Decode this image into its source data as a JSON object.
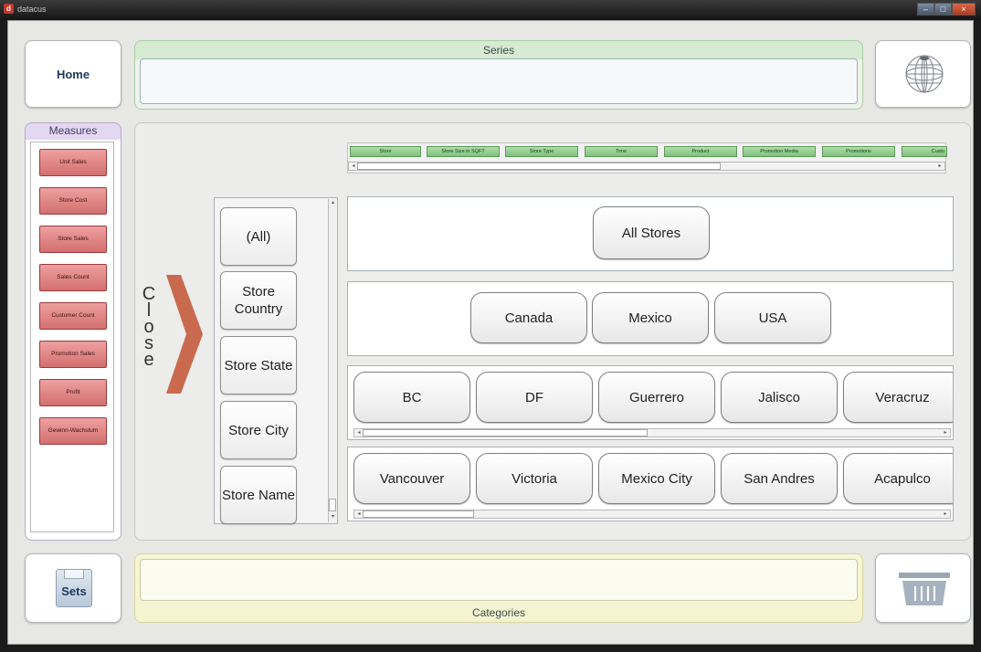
{
  "window": {
    "title": "datacus",
    "app_icon": "app-logo-icon",
    "controls": [
      "minimize-icon",
      "maximize-icon",
      "close-icon"
    ]
  },
  "buttons": {
    "home": "Home",
    "sets": "Sets",
    "globe_icon": "globe-icon",
    "basket_icon": "basket-icon"
  },
  "series": {
    "label": "Series"
  },
  "categories": {
    "label": "Categories"
  },
  "measures": {
    "title": "Measures",
    "items": [
      "Unit Sales",
      "Store Cost",
      "Store Sales",
      "Sales Count",
      "Customer Count",
      "Promotion Sales",
      "Profit",
      "Gewinn-Wachstum"
    ]
  },
  "close_panel": {
    "letters": [
      "C",
      "l",
      "o",
      "s",
      "e"
    ],
    "arrow_icon": "chevron-right-icon",
    "arrow_color": "#c96a4f"
  },
  "dimensions": [
    "Store",
    "Store Size in SQFT",
    "Store Type",
    "Time",
    "Product",
    "Promotion Media",
    "Promotions",
    "Custo"
  ],
  "levels": [
    "(All)",
    "Store Country",
    "Store State",
    "Store City",
    "Store Name"
  ],
  "rows": {
    "all": [
      "All Stores"
    ],
    "country": [
      "Canada",
      "Mexico",
      "USA"
    ],
    "state": [
      "BC",
      "DF",
      "Guerrero",
      "Jalisco",
      "Veracruz"
    ],
    "city": [
      "Vancouver",
      "Victoria",
      "Mexico City",
      "San Andres",
      "Acapulco"
    ]
  },
  "colors": {
    "measure": "#d97a7a",
    "dimension": "#9fd39b",
    "series_header": "#d7ead2",
    "categories": "#f4f4cf",
    "measures_header": "#e3d7f2"
  }
}
